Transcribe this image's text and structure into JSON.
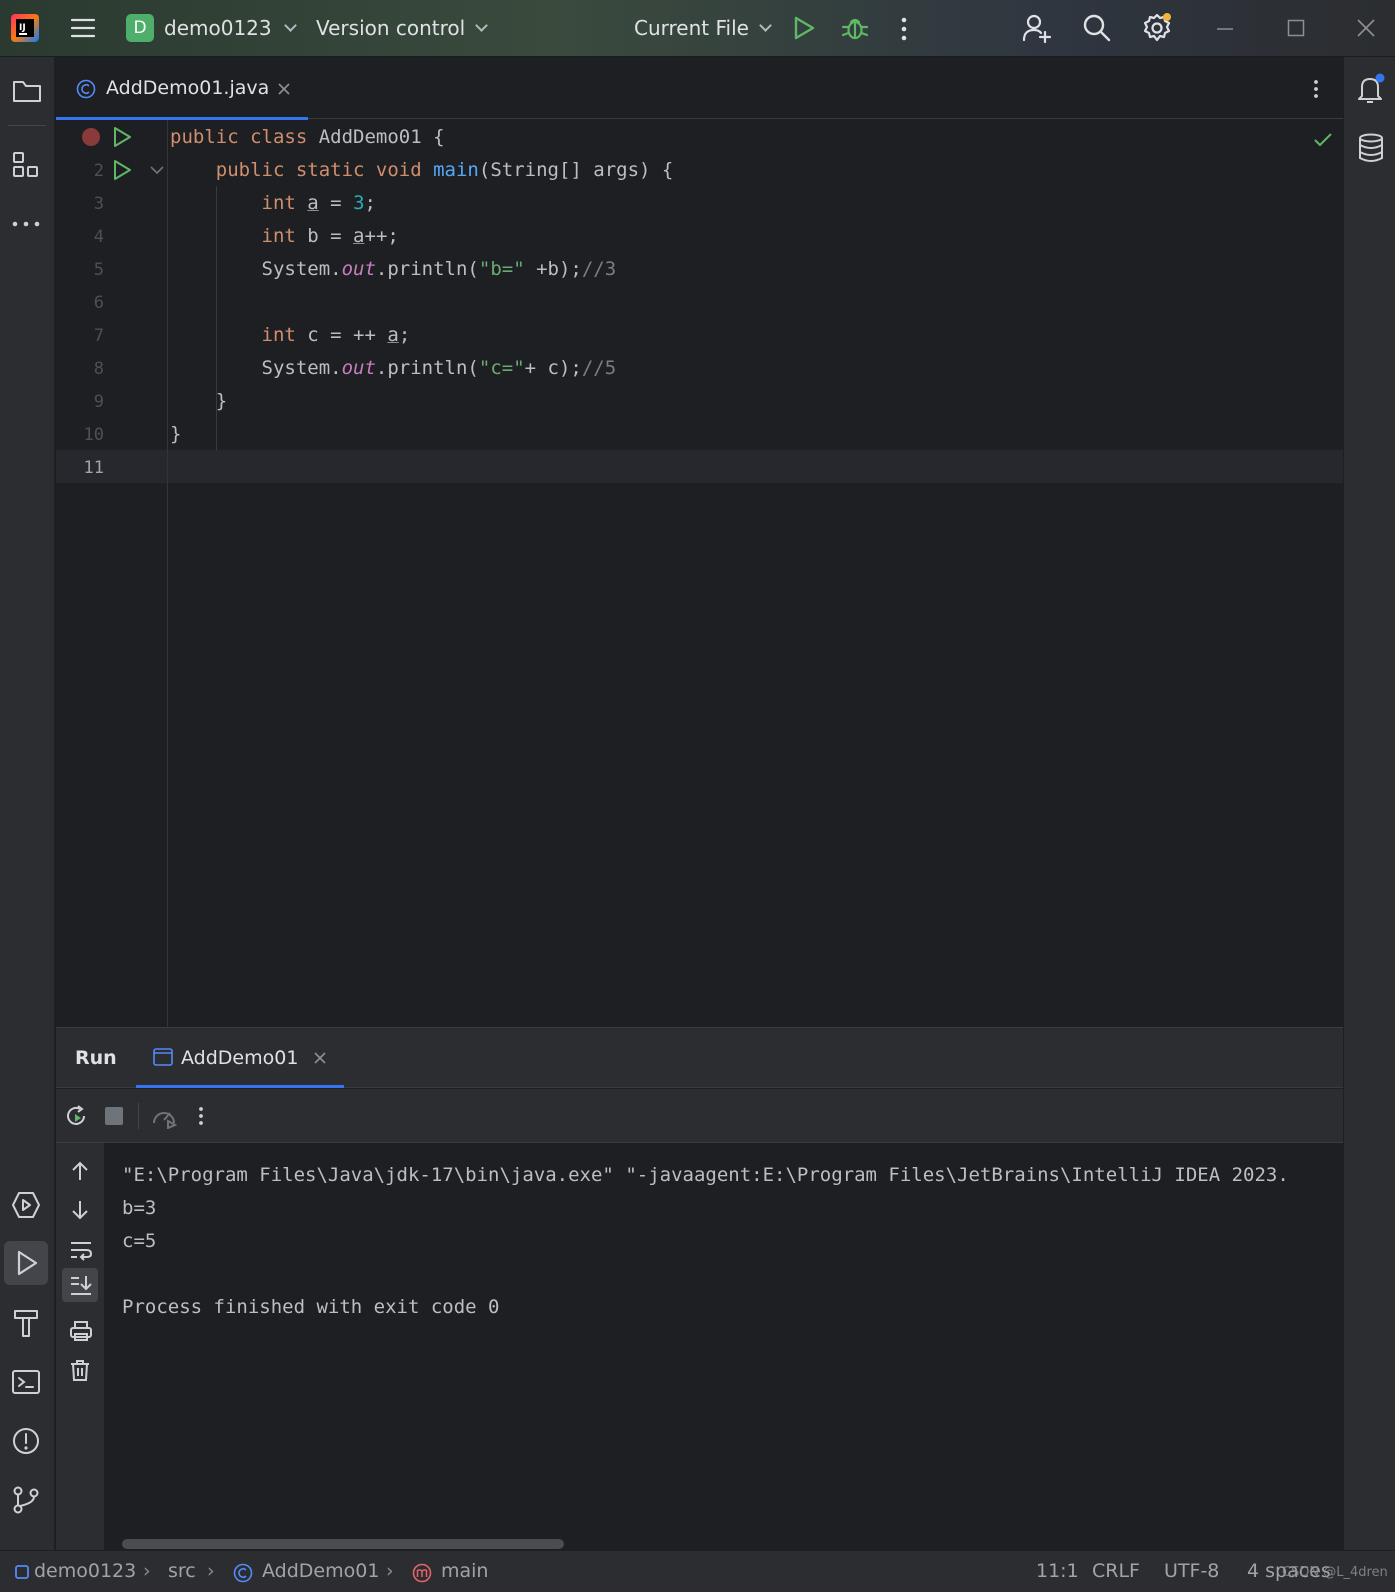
{
  "titlebar": {
    "project_badge": "D",
    "project_name": "demo0123",
    "version_control": "Version control",
    "run_config": "Current File"
  },
  "editor": {
    "tab_name": "AddDemo01.java",
    "line_numbers": [
      "2",
      "3",
      "4",
      "5",
      "6",
      "7",
      "8",
      "9",
      "10",
      "11"
    ],
    "lines": [
      [
        {
          "t": "public class ",
          "c": "kw"
        },
        {
          "t": "AddDemo01 {",
          "c": ""
        }
      ],
      [
        {
          "t": "    public static void ",
          "c": "kw"
        },
        {
          "t": "main",
          "c": "fn"
        },
        {
          "t": "(String[] args) {",
          "c": ""
        }
      ],
      [
        {
          "t": "        ",
          "c": ""
        },
        {
          "t": "int ",
          "c": "kw"
        },
        {
          "t": "a",
          "c": "u"
        },
        {
          "t": " = ",
          "c": ""
        },
        {
          "t": "3",
          "c": "num"
        },
        {
          "t": ";",
          "c": ""
        }
      ],
      [
        {
          "t": "        ",
          "c": ""
        },
        {
          "t": "int ",
          "c": "kw"
        },
        {
          "t": "b = ",
          "c": ""
        },
        {
          "t": "a",
          "c": "u"
        },
        {
          "t": "++;",
          "c": ""
        }
      ],
      [
        {
          "t": "        System.",
          "c": ""
        },
        {
          "t": "out",
          "c": "fld"
        },
        {
          "t": ".println(",
          "c": ""
        },
        {
          "t": "\"b=\"",
          "c": "str"
        },
        {
          "t": " +b);",
          "c": ""
        },
        {
          "t": "//3",
          "c": "cmt"
        }
      ],
      [
        {
          "t": "",
          "c": ""
        }
      ],
      [
        {
          "t": "        ",
          "c": ""
        },
        {
          "t": "int ",
          "c": "kw"
        },
        {
          "t": "c = ++ ",
          "c": ""
        },
        {
          "t": "a",
          "c": "u"
        },
        {
          "t": ";",
          "c": ""
        }
      ],
      [
        {
          "t": "        System.",
          "c": ""
        },
        {
          "t": "out",
          "c": "fld"
        },
        {
          "t": ".println(",
          "c": ""
        },
        {
          "t": "\"c=\"",
          "c": "str"
        },
        {
          "t": "+ c);",
          "c": ""
        },
        {
          "t": "//5",
          "c": "cmt"
        }
      ],
      [
        {
          "t": "    }",
          "c": ""
        }
      ],
      [
        {
          "t": "}",
          "c": ""
        }
      ],
      [
        {
          "t": "",
          "c": ""
        }
      ]
    ]
  },
  "run": {
    "title": "Run",
    "tab_name": "AddDemo01",
    "output": [
      "\"E:\\Program Files\\Java\\jdk-17\\bin\\java.exe\" \"-javaagent:E:\\Program Files\\JetBrains\\IntelliJ IDEA 2023.",
      "b=3",
      "c=5",
      "",
      "Process finished with exit code 0"
    ]
  },
  "statusbar": {
    "project": "demo0123",
    "src": "src",
    "class": "AddDemo01",
    "method": "main",
    "position": "11:1",
    "line_sep": "CRLF",
    "encoding": "UTF-8",
    "indent": "4 spaces",
    "watermark": "CSDN @L_4dren"
  },
  "colors": {
    "accent": "#3574f0",
    "run_green": "#5fb865",
    "breakpoint": "#8a3a3a"
  }
}
